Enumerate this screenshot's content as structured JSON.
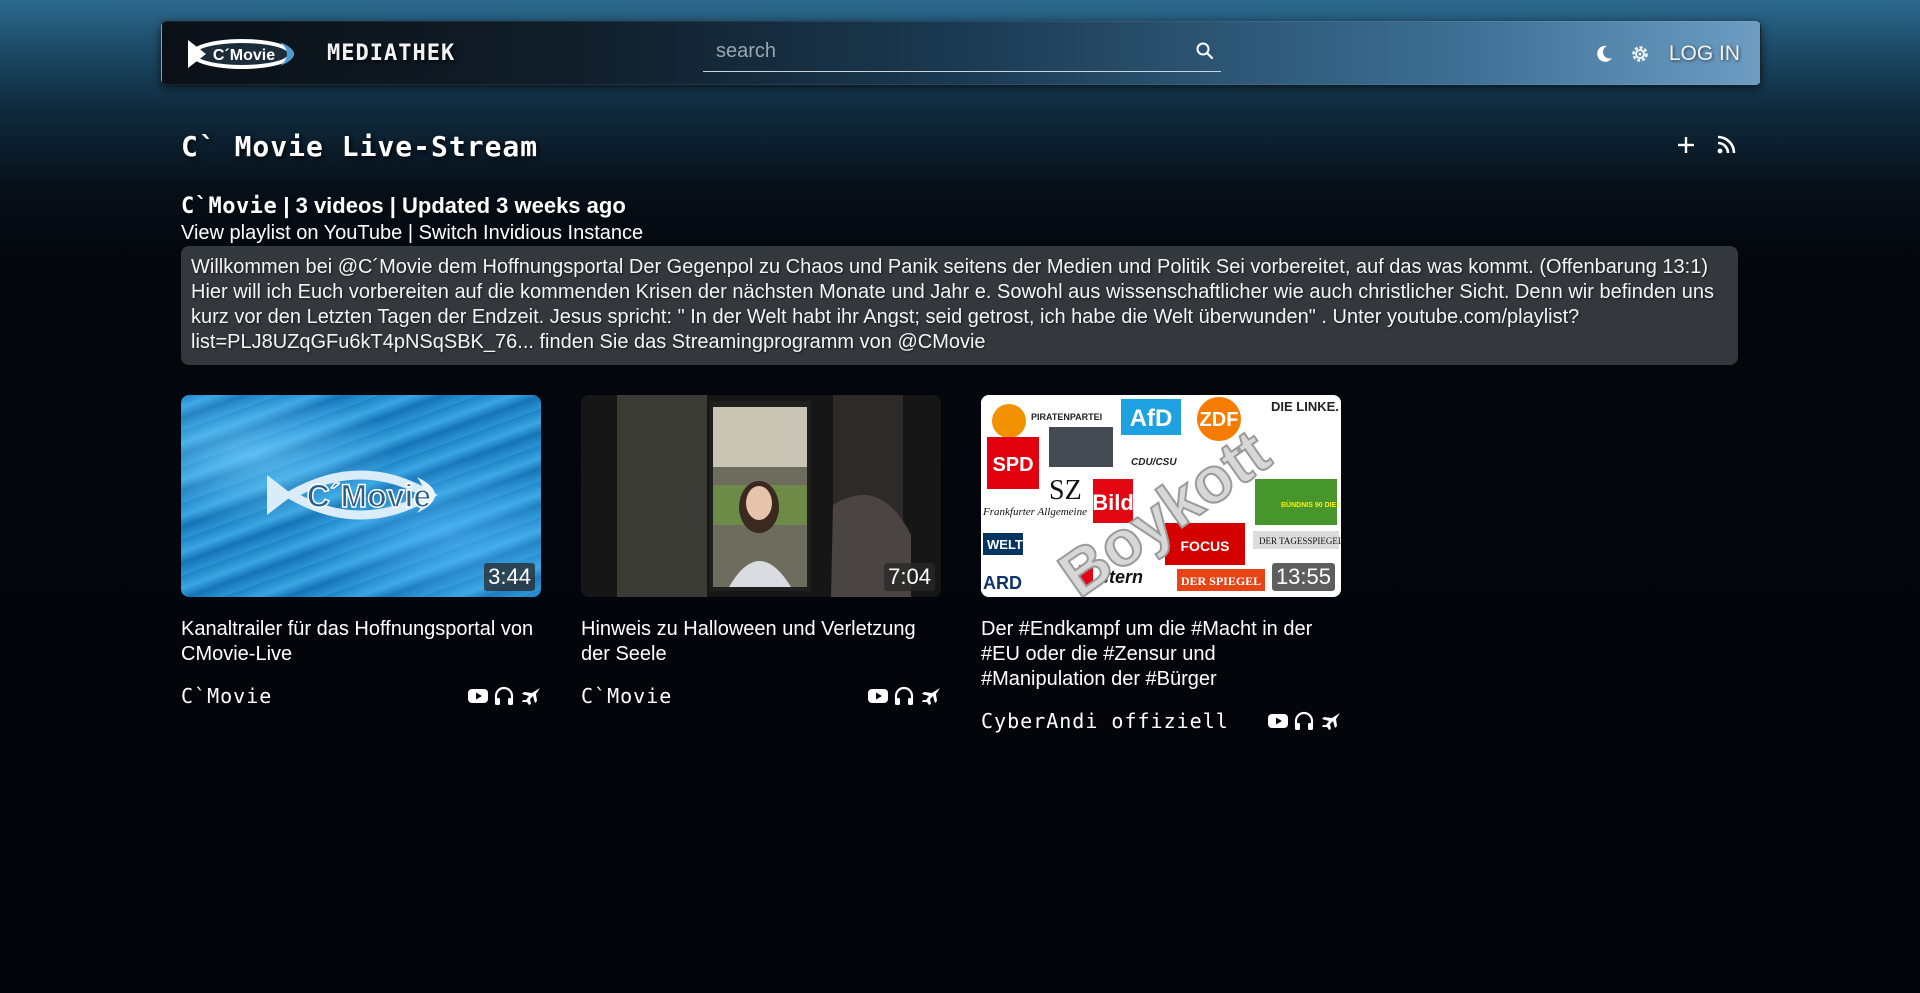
{
  "header": {
    "brand": "MEDIATHEK",
    "logo_text": "C´Movie",
    "search": {
      "placeholder": "search",
      "value": ""
    },
    "login_label": "LOG IN",
    "icons": [
      "moon-icon",
      "gear-icon",
      "search-icon"
    ]
  },
  "playlist": {
    "title": "C` Movie Live-Stream",
    "channel": "C`Movie",
    "stats": " | 3 videos | Updated 3 weeks ago",
    "view_on_youtube": "View playlist on YouTube",
    "separator": " | ",
    "switch_instance": "Switch Invidious Instance",
    "description": "Willkommen bei @C´Movie dem Hoffnungsportal   Der Gegenpol zu Chaos und Panik seitens der Medien und Politik   Sei vorbereitet,  auf das was kommt. (Offenbarung 13:1)    Hier will ich Euch vorbereiten auf die kommenden Krisen der nächsten Monate und Jahr e. Sowohl aus wissenschaftlicher wie auch christlicher Sicht. Denn wir befinden uns kurz vor den Letzten Tagen der Endzeit.  Jesus spricht: \" In der Welt habt ihr Angst; seid getrost, ich habe die Welt überwunden\" . Unter youtube.com/playlist?list=PLJ8UZqGFu6kT4pNSqSBK_76... finden Sie das Streamingprogramm von @CMovie",
    "actions": [
      "plus-icon",
      "rss-icon"
    ]
  },
  "videos": [
    {
      "title": "Kanaltrailer für das Hoffnungsportal von CMovie-Live",
      "duration": "3:44",
      "author": "C`Movie",
      "thumb_text": "C´Movie"
    },
    {
      "title": "Hinweis zu Halloween und Verletzung der Seele",
      "duration": "7:04",
      "author": "C`Movie"
    },
    {
      "title": "Der #Endkampf um die #Macht in der #EU oder die #Zensur und #Manipulation der #Bürger",
      "duration": "13:55",
      "author": "CyberAndi offiziell",
      "thumb_labels": {
        "piraten": "PIRATENPARTEI",
        "afd": "AfD",
        "zdf": "ZDF",
        "linke": "DIE LINKE.",
        "spd": "SPD",
        "sz": "SZ",
        "cdu": "CDU/CSU",
        "faz": "Frankfurter Allgemeine",
        "bild": "Bild",
        "gruene": "BÜNDNIS 90 DIE GRÜNEN",
        "welt": "WELT",
        "focus": "FOCUS",
        "tagesspiegel": "DER TAGESSPIEGEL",
        "ard": "ARD",
        "stern": "stern",
        "spiegel": "DER SPIEGEL",
        "overlay": "Boykott"
      }
    }
  ]
}
